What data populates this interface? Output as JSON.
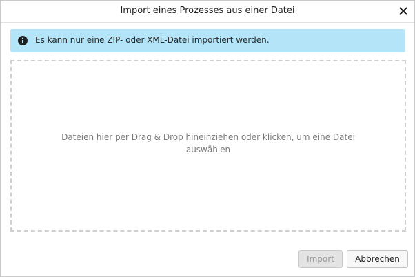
{
  "dialog": {
    "title": "Import eines Prozesses aus einer Datei",
    "close_icon": "close-icon"
  },
  "info": {
    "icon": "info-circle-icon",
    "text": "Es kann nur eine ZIP- oder XML-Datei importiert werden.",
    "background_color": "#b3e4f8"
  },
  "dropzone": {
    "text": "Dateien hier per Drag & Drop hineinziehen oder klicken, um eine Datei auswählen"
  },
  "buttons": {
    "import_label": "Import",
    "import_disabled": true,
    "cancel_label": "Abbrechen"
  }
}
